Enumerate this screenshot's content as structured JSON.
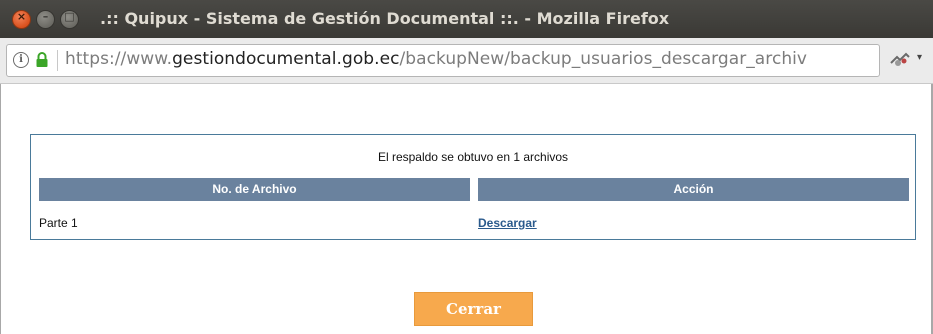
{
  "window": {
    "title": ".:: Quipux - Sistema de Gestión Documental ::. - Mozilla Firefox",
    "close_glyph": "×",
    "minimize_glyph": "–",
    "maximize_glyph": "□"
  },
  "urlbar": {
    "info_glyph": "i",
    "url_prefix": "https://www.",
    "url_domain": "gestiondocumental.gob.ec",
    "url_path": "/backupNew/backup_usuarios_descargar_archiv",
    "icons": [
      "info-icon",
      "lock-icon",
      "extension-icon",
      "menu-caret-icon"
    ],
    "lock_color": "#3ba528",
    "menu_glyph": "▾"
  },
  "backup": {
    "summary": "El respaldo se obtuvo en 1 archivos",
    "columns": [
      "No. de Archivo",
      "Acción"
    ],
    "rows": [
      {
        "file": "Parte 1",
        "action": "Descargar"
      }
    ],
    "header_color": "#6a829e"
  },
  "footer": {
    "close_label": "Cerrar",
    "button_color": "#f7a94d"
  }
}
